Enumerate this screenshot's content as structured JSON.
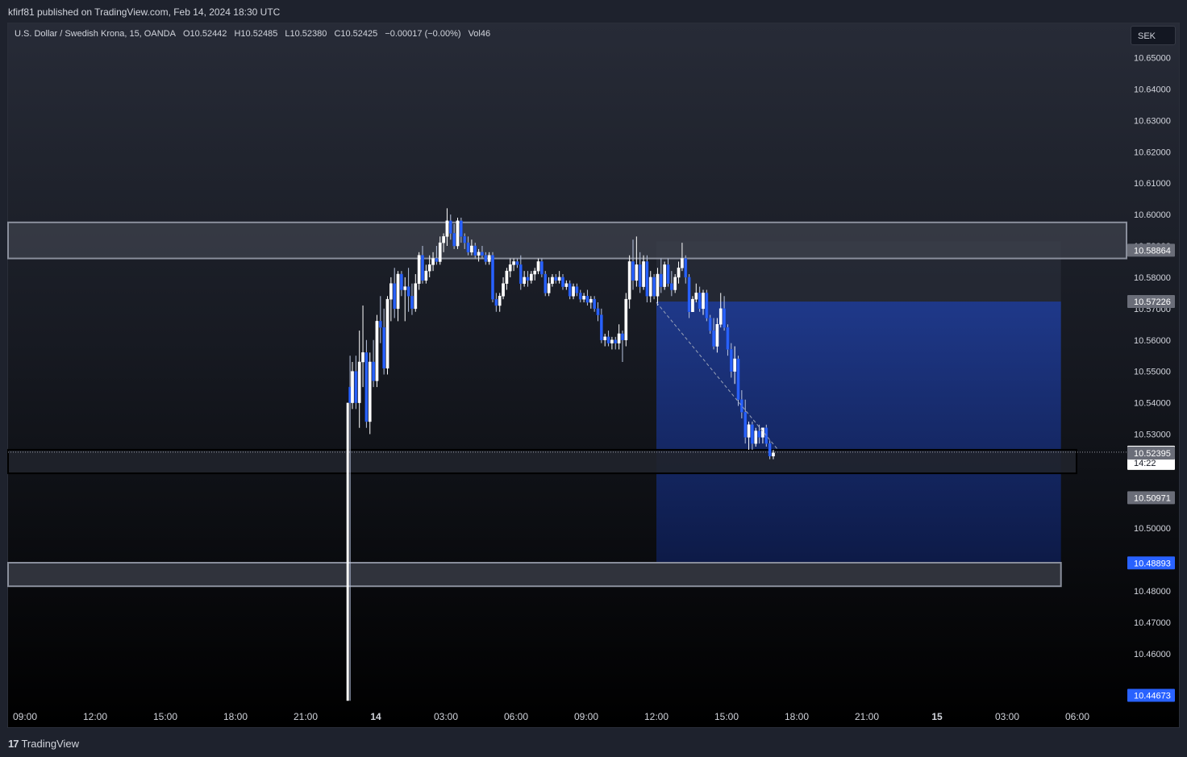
{
  "header": {
    "published": "kfirf81 published on TradingView.com, Feb 14, 2024 18:30 UTC"
  },
  "legend": {
    "symbol": "U.S. Dollar / Swedish Krona, 15, OANDA",
    "open": "O10.52442",
    "high": "H10.52485",
    "low": "L10.52380",
    "close": "C10.52425",
    "change": "−0.00017 (−0.00%)",
    "volume": "Vol46"
  },
  "currency_button": {
    "label": "SEK"
  },
  "footer": {
    "logo_text": "TradingView"
  },
  "colors": {
    "up": "#ffffff",
    "down": "#2962ff",
    "zone": "#8a8f9c",
    "short_target": "#1e3a8a",
    "badge_blue": "#2962ff",
    "badge_gray": "#6a6d78"
  },
  "chart_data": {
    "type": "candlestick",
    "timeframe": "15",
    "ylim": [
      10.443,
      10.654
    ],
    "y_ticks": [
      10.65,
      10.64,
      10.63,
      10.62,
      10.61,
      10.6,
      10.59,
      10.58,
      10.57,
      10.56,
      10.55,
      10.54,
      10.53,
      10.52,
      10.51,
      10.5,
      10.49,
      10.48,
      10.47,
      10.46
    ],
    "x_ticks": [
      {
        "label": "09:00",
        "t": 0
      },
      {
        "label": "12:00",
        "t": 3
      },
      {
        "label": "15:00",
        "t": 6
      },
      {
        "label": "18:00",
        "t": 9
      },
      {
        "label": "21:00",
        "t": 12
      },
      {
        "label": "14",
        "t": 15,
        "bold": true
      },
      {
        "label": "03:00",
        "t": 18
      },
      {
        "label": "06:00",
        "t": 21
      },
      {
        "label": "09:00",
        "t": 24
      },
      {
        "label": "12:00",
        "t": 27
      },
      {
        "label": "15:00",
        "t": 30
      },
      {
        "label": "18:00",
        "t": 33
      },
      {
        "label": "21:00",
        "t": 36
      },
      {
        "label": "15",
        "t": 39,
        "bold": true
      },
      {
        "label": "03:00",
        "t": 42
      },
      {
        "label": "06:00",
        "t": 45
      }
    ],
    "candles": [
      [
        13.9,
        10.545,
        10.555,
        10.445,
        10.54
      ],
      [
        14.0,
        10.54,
        10.553,
        10.538,
        10.55
      ],
      [
        14.15,
        10.55,
        10.555,
        10.538,
        10.54
      ],
      [
        14.3,
        10.54,
        10.563,
        10.532,
        10.553
      ],
      [
        14.45,
        10.553,
        10.571,
        10.545,
        10.556
      ],
      [
        14.6,
        10.556,
        10.56,
        10.532,
        10.534
      ],
      [
        14.75,
        10.534,
        10.556,
        10.53,
        10.553
      ],
      [
        14.9,
        10.553,
        10.56,
        10.545,
        10.547
      ],
      [
        15.05,
        10.547,
        10.568,
        10.545,
        10.566
      ],
      [
        15.2,
        10.566,
        10.574,
        10.559,
        10.564
      ],
      [
        15.35,
        10.564,
        10.57,
        10.549,
        10.551
      ],
      [
        15.5,
        10.551,
        10.574,
        10.549,
        10.573
      ],
      [
        15.65,
        10.573,
        10.58,
        10.566,
        10.578
      ],
      [
        15.8,
        10.578,
        10.583,
        10.567,
        10.57
      ],
      [
        15.95,
        10.57,
        10.582,
        10.566,
        10.581
      ],
      [
        16.1,
        10.581,
        10.582,
        10.574,
        10.576
      ],
      [
        16.25,
        10.576,
        10.58,
        10.566,
        10.577
      ],
      [
        16.4,
        10.577,
        10.583,
        10.569,
        10.574
      ],
      [
        16.55,
        10.574,
        10.578,
        10.568,
        10.57
      ],
      [
        16.7,
        10.57,
        10.581,
        10.569,
        10.578
      ],
      [
        16.85,
        10.578,
        10.588,
        10.576,
        10.587
      ],
      [
        17.0,
        10.587,
        10.59,
        10.578,
        10.579
      ],
      [
        17.15,
        10.579,
        10.584,
        10.578,
        10.582
      ],
      [
        17.3,
        10.582,
        10.587,
        10.58,
        10.584
      ],
      [
        17.45,
        10.584,
        10.588,
        10.582,
        10.586
      ],
      [
        17.6,
        10.586,
        10.59,
        10.584,
        10.585
      ],
      [
        17.75,
        10.585,
        10.593,
        10.584,
        10.591
      ],
      [
        17.9,
        10.591,
        10.594,
        10.588,
        10.593
      ],
      [
        18.05,
        10.593,
        10.602,
        10.59,
        10.598
      ],
      [
        18.2,
        10.598,
        10.6,
        10.592,
        10.594
      ],
      [
        18.35,
        10.594,
        10.597,
        10.589,
        10.59
      ],
      [
        18.5,
        10.59,
        10.599,
        10.589,
        10.598
      ],
      [
        18.65,
        10.598,
        10.599,
        10.591,
        10.593
      ],
      [
        18.8,
        10.593,
        10.594,
        10.589,
        10.591
      ],
      [
        18.95,
        10.591,
        10.593,
        10.587,
        10.588
      ],
      [
        19.1,
        10.588,
        10.592,
        10.587,
        10.59
      ],
      [
        19.25,
        10.59,
        10.591,
        10.586,
        10.587
      ],
      [
        19.4,
        10.587,
        10.589,
        10.585,
        10.588
      ],
      [
        19.55,
        10.588,
        10.59,
        10.586,
        10.587
      ],
      [
        19.7,
        10.587,
        10.588,
        10.584,
        10.585
      ],
      [
        19.85,
        10.585,
        10.588,
        10.584,
        10.587
      ],
      [
        20.0,
        10.587,
        10.588,
        10.572,
        10.573
      ],
      [
        20.15,
        10.573,
        10.575,
        10.569,
        10.571
      ],
      [
        20.3,
        10.571,
        10.575,
        10.569,
        10.574
      ],
      [
        20.45,
        10.574,
        10.58,
        10.573,
        10.578
      ],
      [
        20.6,
        10.578,
        10.583,
        10.576,
        10.582
      ],
      [
        20.75,
        10.582,
        10.586,
        10.58,
        10.584
      ],
      [
        20.9,
        10.584,
        10.586,
        10.582,
        10.585
      ],
      [
        21.05,
        10.585,
        10.586,
        10.583,
        10.584
      ],
      [
        21.2,
        10.584,
        10.587,
        10.576,
        10.578
      ],
      [
        21.35,
        10.578,
        10.582,
        10.577,
        10.58
      ],
      [
        21.5,
        10.58,
        10.582,
        10.577,
        10.579
      ],
      [
        21.65,
        10.579,
        10.582,
        10.578,
        10.581
      ],
      [
        21.8,
        10.581,
        10.583,
        10.579,
        10.582
      ],
      [
        21.95,
        10.582,
        10.586,
        10.581,
        10.585
      ],
      [
        22.1,
        10.585,
        10.586,
        10.58,
        10.581
      ],
      [
        22.25,
        10.581,
        10.582,
        10.574,
        10.575
      ],
      [
        22.4,
        10.575,
        10.58,
        10.574,
        10.578
      ],
      [
        22.55,
        10.578,
        10.581,
        10.577,
        10.58
      ],
      [
        22.7,
        10.58,
        10.581,
        10.578,
        10.579
      ],
      [
        22.85,
        10.579,
        10.582,
        10.578,
        10.58
      ],
      [
        23.0,
        10.58,
        10.581,
        10.576,
        10.577
      ],
      [
        23.15,
        10.577,
        10.579,
        10.576,
        10.578
      ],
      [
        23.3,
        10.578,
        10.579,
        10.573,
        10.574
      ],
      [
        23.45,
        10.574,
        10.578,
        10.573,
        10.577
      ],
      [
        23.6,
        10.577,
        10.578,
        10.574,
        10.575
      ],
      [
        23.75,
        10.575,
        10.576,
        10.572,
        10.573
      ],
      [
        23.9,
        10.573,
        10.575,
        10.572,
        10.574
      ],
      [
        24.05,
        10.574,
        10.576,
        10.571,
        10.572
      ],
      [
        24.2,
        10.572,
        10.574,
        10.57,
        10.573
      ],
      [
        24.35,
        10.573,
        10.574,
        10.569,
        10.57
      ],
      [
        24.5,
        10.57,
        10.572,
        10.566,
        10.568
      ],
      [
        24.65,
        10.568,
        10.57,
        10.559,
        10.56
      ],
      [
        24.8,
        10.56,
        10.562,
        10.558,
        10.561
      ],
      [
        24.95,
        10.561,
        10.563,
        10.558,
        10.559
      ],
      [
        25.1,
        10.559,
        10.561,
        10.557,
        10.56
      ],
      [
        25.25,
        10.56,
        10.561,
        10.557,
        10.559
      ],
      [
        25.4,
        10.559,
        10.565,
        10.557,
        10.562
      ],
      [
        25.55,
        10.562,
        10.563,
        10.553,
        10.56
      ],
      [
        25.7,
        10.56,
        10.575,
        10.558,
        10.573
      ],
      [
        25.85,
        10.573,
        10.587,
        10.57,
        10.585
      ],
      [
        26.0,
        10.585,
        10.592,
        10.576,
        10.579
      ],
      [
        26.15,
        10.579,
        10.593,
        10.577,
        10.584
      ],
      [
        26.3,
        10.584,
        10.588,
        10.575,
        10.577
      ],
      [
        26.45,
        10.577,
        10.587,
        10.576,
        10.585
      ],
      [
        26.6,
        10.585,
        10.587,
        10.572,
        10.574
      ],
      [
        26.75,
        10.574,
        10.582,
        10.572,
        10.58
      ],
      [
        26.9,
        10.58,
        10.581,
        10.573,
        10.574
      ],
      [
        27.05,
        10.574,
        10.583,
        10.571,
        10.581
      ],
      [
        27.2,
        10.581,
        10.586,
        10.575,
        10.577
      ],
      [
        27.35,
        10.577,
        10.585,
        10.576,
        10.584
      ],
      [
        27.5,
        10.584,
        10.586,
        10.577,
        10.578
      ],
      [
        27.65,
        10.578,
        10.582,
        10.574,
        10.576
      ],
      [
        27.8,
        10.576,
        10.581,
        10.575,
        10.58
      ],
      [
        27.95,
        10.58,
        10.585,
        10.578,
        10.583
      ],
      [
        28.1,
        10.583,
        10.591,
        10.582,
        10.586
      ],
      [
        28.25,
        10.586,
        10.587,
        10.578,
        10.58
      ],
      [
        28.4,
        10.58,
        10.581,
        10.567,
        10.569
      ],
      [
        28.55,
        10.569,
        10.574,
        10.569,
        10.573
      ],
      [
        28.7,
        10.573,
        10.578,
        10.572,
        10.575
      ],
      [
        28.85,
        10.575,
        10.577,
        10.569,
        10.57
      ],
      [
        29.0,
        10.57,
        10.576,
        10.568,
        10.575
      ],
      [
        29.15,
        10.575,
        10.576,
        10.566,
        10.567
      ],
      [
        29.3,
        10.567,
        10.568,
        10.562,
        10.563
      ],
      [
        29.45,
        10.563,
        10.567,
        10.557,
        10.558
      ],
      [
        29.6,
        10.558,
        10.567,
        10.556,
        10.565
      ],
      [
        29.75,
        10.565,
        10.575,
        10.564,
        10.57
      ],
      [
        29.9,
        10.57,
        10.574,
        10.563,
        10.564
      ],
      [
        30.05,
        10.564,
        10.565,
        10.555,
        10.557
      ],
      [
        30.2,
        10.557,
        10.559,
        10.548,
        10.55
      ],
      [
        30.35,
        10.55,
        10.558,
        10.546,
        10.554
      ],
      [
        30.5,
        10.554,
        10.555,
        10.539,
        10.541
      ],
      [
        30.65,
        10.541,
        10.544,
        10.535,
        10.537
      ],
      [
        30.8,
        10.537,
        10.541,
        10.527,
        10.529
      ],
      [
        30.95,
        10.529,
        10.534,
        10.525,
        10.533
      ],
      [
        31.1,
        10.533,
        10.534,
        10.525,
        10.527
      ],
      [
        31.25,
        10.527,
        10.532,
        10.526,
        10.531
      ],
      [
        31.4,
        10.531,
        10.533,
        10.527,
        10.529
      ],
      [
        31.55,
        10.529,
        10.532,
        10.527,
        10.532
      ],
      [
        31.7,
        10.532,
        10.533,
        10.526,
        10.527
      ],
      [
        31.85,
        10.527,
        10.528,
        10.522,
        10.523
      ],
      [
        32.0,
        10.523,
        10.525,
        10.522,
        10.524
      ]
    ],
    "zones": [
      {
        "name": "supply-zone",
        "y_top": 10.5975,
        "y_bottom": 10.586
      },
      {
        "name": "current-zone",
        "y_top": 10.525,
        "y_bottom": 10.5175
      },
      {
        "name": "demand-zone",
        "y_top": 10.489,
        "y_bottom": 10.4815
      }
    ],
    "short_position": {
      "t_start": 27.0,
      "t_end": 44.3,
      "entry": 10.57226,
      "target": 10.48893
    },
    "dashed_line": [
      {
        "t": 27.0,
        "y": 10.572
      },
      {
        "t": 32.2,
        "y": 10.525
      }
    ],
    "big_wick": {
      "t": 13.8,
      "y_top": 10.54,
      "y_bottom": 10.445
    },
    "current_price": 10.52425,
    "price_badges": [
      {
        "label": "10.58864",
        "y": 10.58864,
        "style": "gray"
      },
      {
        "label": "10.57226",
        "y": 10.57226,
        "style": "gray"
      },
      {
        "label": "10.52425",
        "sub": "14:22",
        "y": 10.52425,
        "style": "white"
      },
      {
        "label": "10.52395",
        "y": 10.52395,
        "style": "gray"
      },
      {
        "label": "10.50971",
        "y": 10.50971,
        "style": "gray"
      },
      {
        "label": "10.48893",
        "y": 10.48893,
        "style": "blue"
      },
      {
        "label": "10.44673",
        "y": 10.44673,
        "style": "blue"
      }
    ]
  }
}
